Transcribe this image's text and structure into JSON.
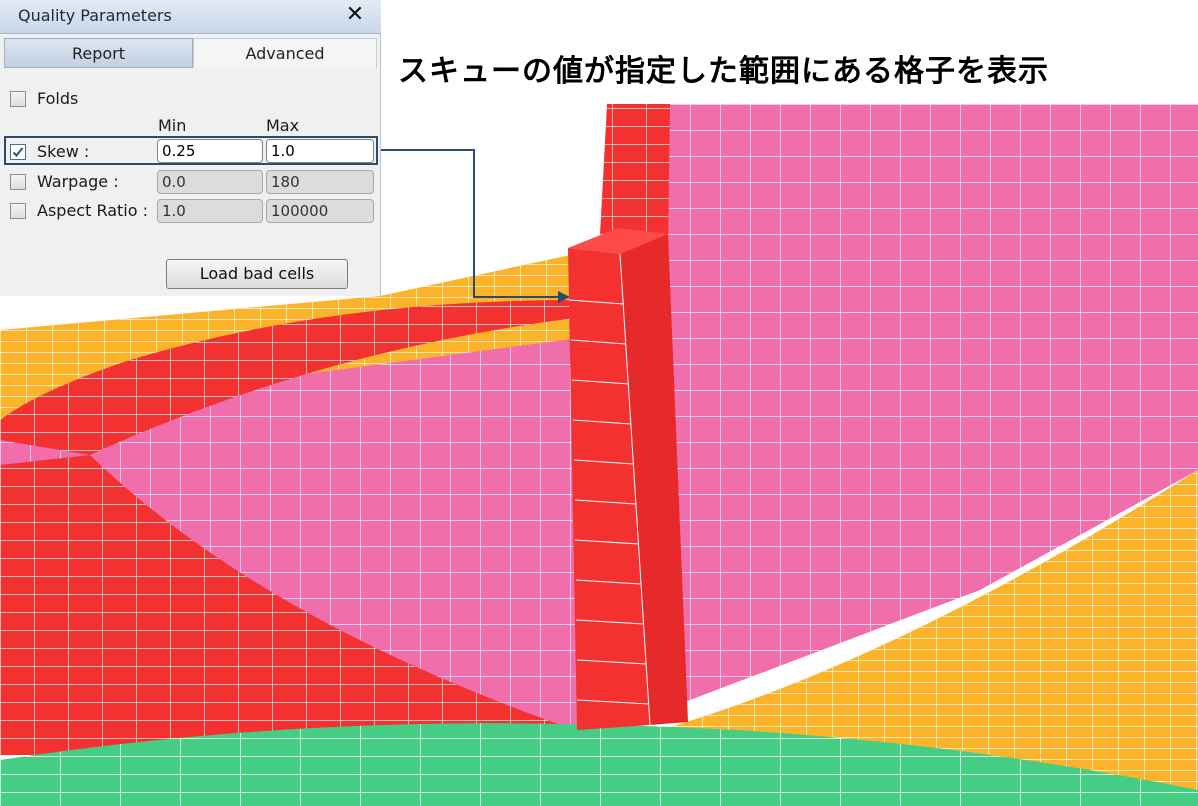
{
  "dialog": {
    "title": "Quality Parameters",
    "close_glyph": "✕",
    "tabs": [
      {
        "label": "Report",
        "active": false
      },
      {
        "label": "Advanced",
        "active": true
      }
    ],
    "folds": {
      "label": "Folds",
      "checked": false
    },
    "columns": {
      "min": "Min",
      "max": "Max"
    },
    "rows": [
      {
        "label": "Skew :",
        "checked": true,
        "min": "0.25",
        "max": "1.0",
        "enabled": true
      },
      {
        "label": "Warpage :",
        "checked": false,
        "min": "0.0",
        "max": "180",
        "enabled": false
      },
      {
        "label": "Aspect Ratio :",
        "checked": false,
        "min": "1.0",
        "max": "100000",
        "enabled": false
      }
    ],
    "load_button": "Load bad cells"
  },
  "annotation": {
    "heading": "スキューの値が指定した範囲にある格子を表示"
  },
  "colors": {
    "bad_cells": "#f33131",
    "pink_wall": "#ef6eab",
    "orange_floor": "#fbb42a",
    "green_floor": "#44cd83",
    "mesh_lines": "#ffffff",
    "arrow": "#2c4a6e"
  },
  "icons": [
    "close-icon",
    "check-icon"
  ]
}
